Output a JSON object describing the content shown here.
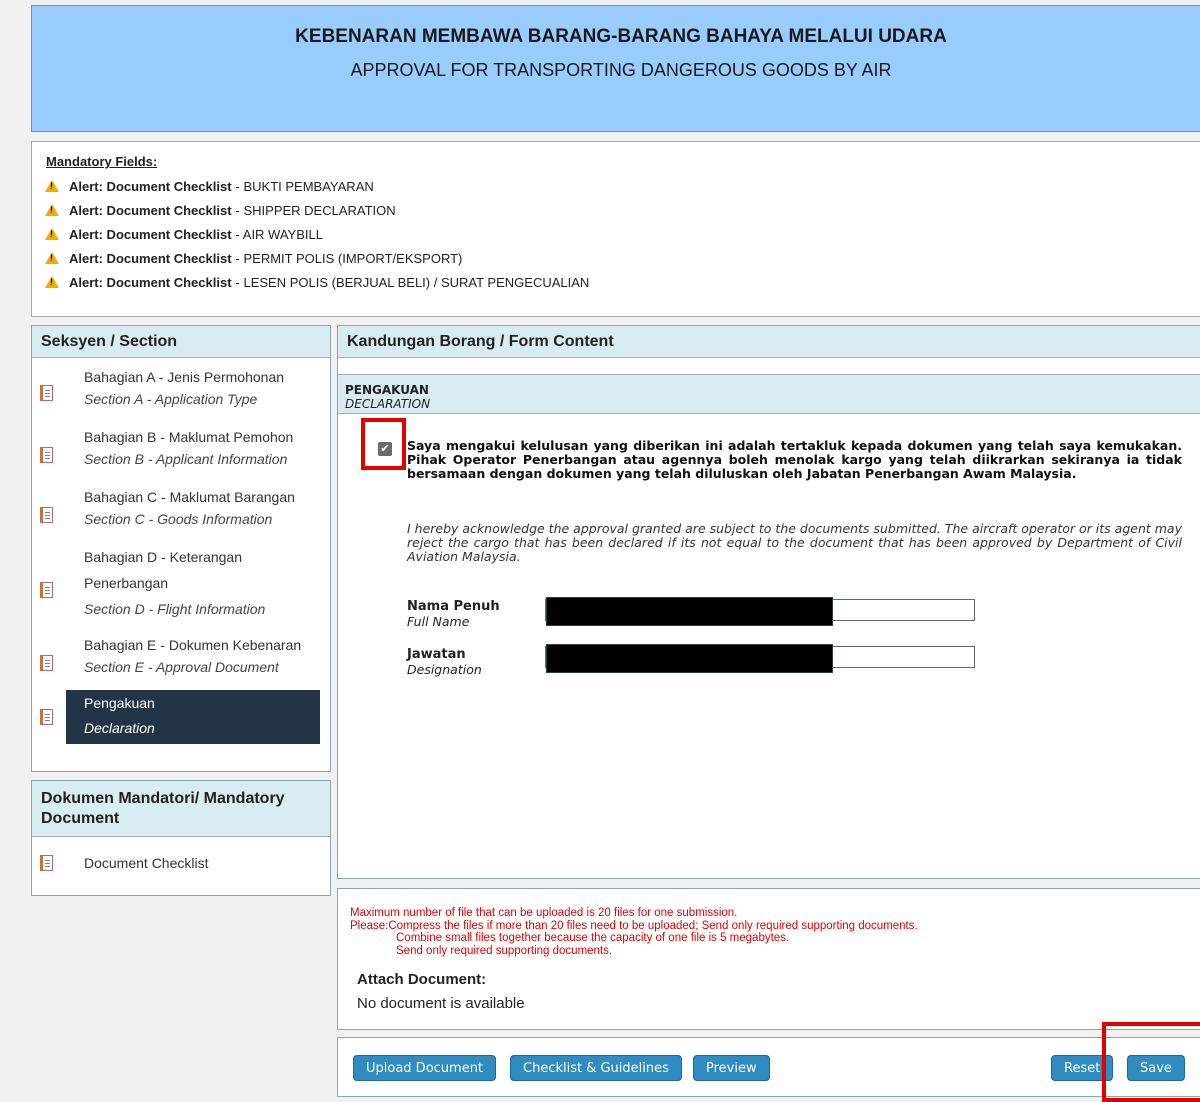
{
  "header": {
    "title_ms": "KEBENARAN MEMBAWA BARANG-BARANG BAHAYA MELALUI UDARA",
    "title_en": "APPROVAL FOR TRANSPORTING DANGEROUS GOODS BY AIR",
    "bg_color": "#99ccff"
  },
  "mandatory": {
    "title": "Mandatory Fields:",
    "alerts": [
      {
        "prefix": "Alert: Document Checklist",
        "text": "- BUKTI PEMBAYARAN"
      },
      {
        "prefix": "Alert: Document Checklist",
        "text": "- SHIPPER DECLARATION"
      },
      {
        "prefix": "Alert: Document Checklist",
        "text": "- AIR WAYBILL"
      },
      {
        "prefix": "Alert: Document Checklist",
        "text": "- PERMIT POLIS (IMPORT/EKSPORT)"
      },
      {
        "prefix": "Alert: Document Checklist",
        "text": "- LESEN POLIS (BERJUAL BELI) / SURAT PENGECUALIAN"
      }
    ],
    "icon": "warning-icon"
  },
  "sections": {
    "title": "Seksyen / Section",
    "items": [
      {
        "l1": "Bahagian A - Jenis Permohonan",
        "l2": "Section A - Application Type"
      },
      {
        "l1": "Bahagian B - Maklumat Pemohon",
        "l2": "Section B - Applicant Information"
      },
      {
        "l1": "Bahagian C - Maklumat Barangan",
        "l2": "Section C - Goods Information"
      },
      {
        "l1a": "Bahagian D - Keterangan",
        "l1b": "Penerbangan",
        "l2": "Section D - Flight Information"
      },
      {
        "l1": "Bahagian E - Dokumen Kebenaran",
        "l2": "Section E - Approval Document"
      },
      {
        "l1": "Pengakuan",
        "l2": "Declaration",
        "active": true
      }
    ]
  },
  "mandatory_doc": {
    "title_line1": "Dokumen Mandatori/ Mandatory",
    "title_line2": "Document",
    "item": "Document Checklist"
  },
  "form": {
    "title": "Kandungan Borang / Form Content",
    "section_ms": "PENGAKUAN",
    "section_en": "DECLARATION",
    "checkbox_checked": true,
    "declaration_ms": "Saya mengakui kelulusan yang diberikan ini adalah tertakluk kepada dokumen yang telah saya kemukakan. Pihak Operator Penerbangan atau agennya boleh menolak kargo yang telah diikrarkan sekiranya ia tidak bersamaan dengan dokumen yang telah diluluskan oleh Jabatan Penerbangan Awam Malaysia.",
    "declaration_en": "I hereby acknowledge the approval granted are subject to the documents submitted. The aircraft operator or its agent may reject the cargo that has been declared if its not equal to the document that has been approved by Department of Civil Aviation Malaysia.",
    "fields": [
      {
        "label_ms": "Nama Penuh",
        "label_en": "Full Name",
        "value": ""
      },
      {
        "label_ms": "Jawatan",
        "label_en": "Designation",
        "value": ""
      }
    ]
  },
  "attach": {
    "note1": "Maximum number of file that can be uploaded is 20 files for one submission.",
    "note2": "Please:Compress the files if more than 20 files need to be uploaded; Send only required supporting documents.",
    "note3": "Combine small files together because the capacity of one file is 5 megabytes.",
    "note4": "Send only required supporting documents.",
    "title": "Attach Document:",
    "empty": "No document is available"
  },
  "buttons": {
    "upload": "Upload Document",
    "checklist": "Checklist & Guidelines",
    "preview": "Preview",
    "reset": "Reset",
    "save": "Save",
    "color": "#2e8cc2"
  },
  "highlight_color": "#e20000"
}
